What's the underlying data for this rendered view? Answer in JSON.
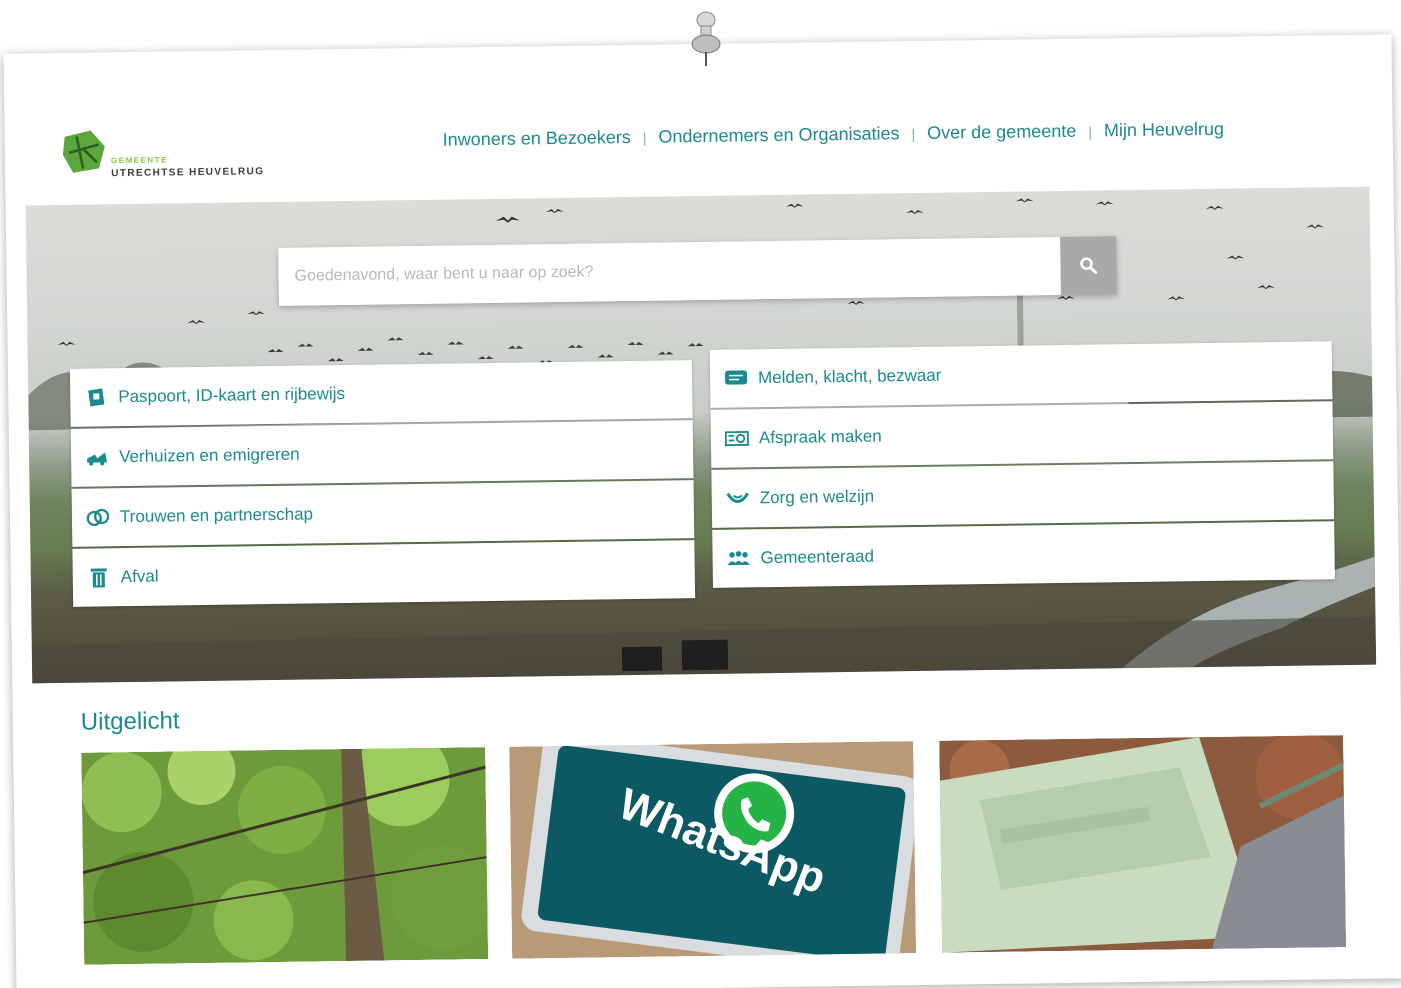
{
  "logo": {
    "small": "GEMEENTE",
    "main": "UTRECHTSE HEUVELRUG"
  },
  "nav": {
    "items": [
      {
        "label": "Inwoners en Bezoekers"
      },
      {
        "label": "Ondernemers en Organisaties"
      },
      {
        "label": "Over de gemeente"
      },
      {
        "label": "Mijn Heuvelrug"
      }
    ]
  },
  "search": {
    "placeholder": "Goedenavond, waar bent u naar op zoek?"
  },
  "tiles": [
    {
      "label": "Paspoort, ID-kaart en rijbewijs",
      "icon": "id-card-icon"
    },
    {
      "label": "Verhuizen en emigreren",
      "icon": "moving-truck-icon"
    },
    {
      "label": "Trouwen en partnerschap",
      "icon": "rings-icon"
    },
    {
      "label": "Afval",
      "icon": "trash-icon"
    },
    {
      "label": "Melden, klacht, bezwaar",
      "icon": "message-icon"
    },
    {
      "label": "Afspraak maken",
      "icon": "appointment-icon"
    },
    {
      "label": "Zorg en welzijn",
      "icon": "care-hands-icon"
    },
    {
      "label": "Gemeenteraad",
      "icon": "council-people-icon"
    }
  ],
  "featured": {
    "title": "Uitgelicht",
    "cards": [
      {
        "image": "tree-leaves-image"
      },
      {
        "image": "whatsapp-phone-image",
        "text": "WhatsApp"
      },
      {
        "image": "green-waste-bin-image"
      }
    ]
  },
  "colors": {
    "accent": "#1b8a8e",
    "logo_green": "#8cc63f",
    "search_button": "#a9a9a9"
  }
}
